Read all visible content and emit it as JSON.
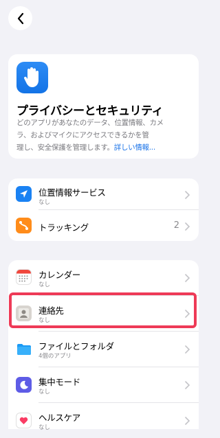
{
  "nav": {
    "back_icon": "chevron-left-icon"
  },
  "hero": {
    "icon": "raised-hand-icon",
    "title": "プライバシーとセキュリティ",
    "desc_line1": "どのアプリがあなたのデータ、位置情報、カメ",
    "desc_line2": "ラ、およびマイクにアクセスできるかを管",
    "desc_line3": "理し、安全保護を管理します。",
    "link": "詳しい情報..."
  },
  "group1": [
    {
      "title": "位置情報サービス",
      "subtitle": "なし",
      "icon": "location-arrow-icon",
      "color": "#1a82f3"
    },
    {
      "title": "トラッキング",
      "count": "2",
      "icon": "tracking-icon",
      "color": "#ff8c1a"
    }
  ],
  "group2": [
    {
      "title": "カレンダー",
      "subtitle": "なし",
      "icon": "calendar-icon"
    },
    {
      "title": "連絡先",
      "subtitle": "なし",
      "icon": "contacts-icon"
    },
    {
      "title": "ファイルとフォルダ",
      "subtitle": "4個のアプリ",
      "icon": "folder-icon"
    },
    {
      "title": "集中モード",
      "subtitle": "なし",
      "icon": "moon-icon"
    },
    {
      "title": "ヘルスケア",
      "subtitle": "なし",
      "icon": "heart-icon"
    }
  ],
  "colors": {
    "highlight": "#ee3a57",
    "link": "#1a73e8",
    "accent": "#1a82f3"
  }
}
